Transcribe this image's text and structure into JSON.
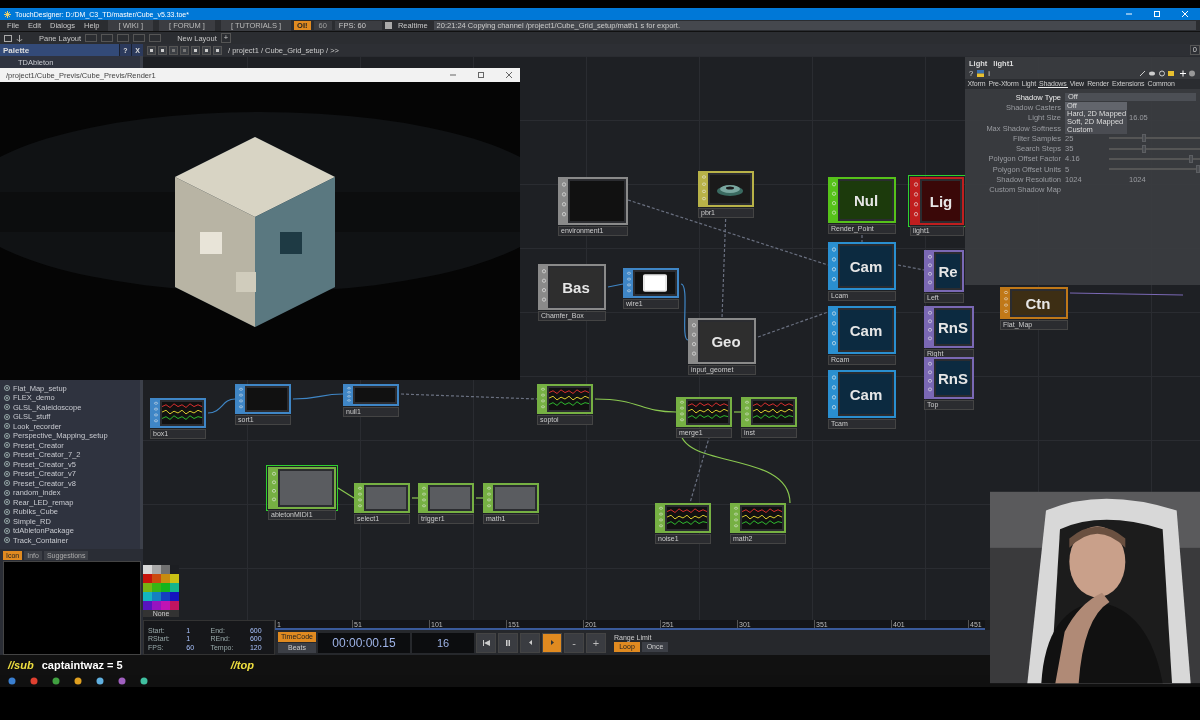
{
  "window": {
    "title": "TouchDesigner: D:/DM_C3_TD/master/Cube_v5.33.toe*"
  },
  "menu": [
    "File",
    "Edit",
    "Dialogs",
    "Help"
  ],
  "toolbar_links": [
    "[ WIKI ]",
    "[ FORUM ]",
    "[ TUTORIALS ]"
  ],
  "status": {
    "alert": "OI!",
    "fps_field": "60",
    "fps": "FPS: 60",
    "realtime": {
      "label": "Realtime",
      "checked": true
    },
    "message": "20:21:24 Copying channel /project1/Cube_Grid_setup/math1 s for export."
  },
  "pane_bar": {
    "pane_layout": "Pane Layout",
    "new_layout": "New Layout",
    "add": "+",
    "counter": "0"
  },
  "palette": {
    "title": "Palette",
    "help": "?",
    "close": "X",
    "first_item": "TDAbleton",
    "items": [
      "Flat_Map_setup",
      "FLEX_demo",
      "GLSL_Kaleidoscope",
      "GLSL_stuff",
      "Look_recorder",
      "Perspective_Mapping_setup",
      "Preset_Creator",
      "Preset_Creator_7_2",
      "Preset_Creator_v5",
      "Preset_Creator_v7",
      "Preset_Creator_v8",
      "random_index",
      "Rear_LED_remap",
      "Rubiks_Cube",
      "Simple_RD",
      "tdAbletonPackage",
      "Track_Container"
    ],
    "tabs": [
      {
        "label": "Icon",
        "selected": true
      },
      {
        "label": "Info",
        "selected": false
      },
      {
        "label": "Suggestions",
        "selected": false
      }
    ]
  },
  "path_bar": {
    "path": "/ project1 / Cube_Grid_setup / >>"
  },
  "render_window": {
    "title": "/project1/Cube_Previs/Cube_Previs/Render1",
    "kind": "picture"
  },
  "nodes": [
    {
      "label": "environment1",
      "kind": "texture",
      "selected": false
    },
    {
      "label": "pbr1",
      "kind": "material",
      "selected": false
    },
    {
      "label": "Render_Point",
      "title": "Nul",
      "kind": "null",
      "selected": false
    },
    {
      "label": "light1",
      "title": "Lig",
      "kind": "light",
      "selected": true
    },
    {
      "label": "Lcam",
      "title": "Cam",
      "kind": "camera",
      "selected": false
    },
    {
      "label": "Rcam",
      "title": "Cam",
      "kind": "camera",
      "selected": false
    },
    {
      "label": "Tcam",
      "title": "Cam",
      "kind": "camera",
      "selected": false
    },
    {
      "label": "Left",
      "title": "Re",
      "kind": "render",
      "selected": false
    },
    {
      "label": "Right",
      "title": "RnS",
      "kind": "render",
      "selected": false
    },
    {
      "label": "Top",
      "title": "RnS",
      "kind": "render",
      "selected": false
    },
    {
      "label": "Flat_Map",
      "title": "Ctn",
      "kind": "container",
      "selected": false
    },
    {
      "label": "Chamfer_Box",
      "title": "Bas",
      "kind": "geometry",
      "selected": false
    },
    {
      "label": "wire1",
      "kind": "wire",
      "selected": false
    },
    {
      "label": "input_geomet",
      "title": "Geo",
      "kind": "geometry",
      "selected": false
    },
    {
      "label": "soptoi",
      "kind": "chop",
      "selected": false
    },
    {
      "label": "merge1",
      "kind": "chop",
      "selected": false
    },
    {
      "label": "inst",
      "kind": "chop",
      "selected": false
    },
    {
      "label": "noise1",
      "kind": "chop",
      "selected": false
    },
    {
      "label": "math2",
      "kind": "chop",
      "selected": false
    },
    {
      "label": "box1",
      "kind": "data",
      "selected": false
    },
    {
      "label": "sort1",
      "kind": "sop",
      "selected": false
    },
    {
      "label": "null1",
      "kind": "sop",
      "selected": false
    },
    {
      "label": "abletonMIDI1",
      "kind": "value",
      "selected": true
    },
    {
      "label": "select1",
      "kind": "value",
      "selected": false
    },
    {
      "label": "trigger1",
      "kind": "value",
      "selected": false
    },
    {
      "label": "math1",
      "kind": "value",
      "selected": false
    }
  ],
  "parameters": {
    "op_type": "Light",
    "op_name": "light1",
    "help": "?",
    "info": "i",
    "tabs": [
      {
        "label": "Xform",
        "selected": false
      },
      {
        "label": "Pre-Xform",
        "selected": false
      },
      {
        "label": "Light",
        "selected": false
      },
      {
        "label": "Shadows",
        "selected": true
      },
      {
        "label": "View",
        "selected": false
      },
      {
        "label": "Render",
        "selected": false
      },
      {
        "label": "Extensions",
        "selected": false
      },
      {
        "label": "Common",
        "selected": false
      }
    ],
    "params": [
      {
        "name": "Shadow Type",
        "kind": "menu",
        "value": "Off",
        "disabled": false
      },
      {
        "name": "Shadow Casters",
        "kind": "field",
        "disabled": true
      },
      {
        "name": "Light Size",
        "kind": "field",
        "value": "16.05",
        "disabled": true
      },
      {
        "name": "Max Shadow Softness",
        "kind": "field",
        "disabled": true
      },
      {
        "name": "Filter Samples",
        "kind": "slider",
        "value": "25",
        "level": 0.39,
        "disabled": true
      },
      {
        "name": "Search Steps",
        "kind": "slider",
        "value": "35",
        "level": 0.39,
        "disabled": true
      },
      {
        "name": "Polygon Offset Factor",
        "kind": "slider",
        "value": "4.16",
        "level": 0.9,
        "disabled": true
      },
      {
        "name": "Polygon Offset Units",
        "kind": "slider",
        "value": "5",
        "level": 0.98,
        "disabled": true
      },
      {
        "name": "Shadow Resolution",
        "kind": "pair",
        "value": "1024",
        "value2": "1024",
        "disabled": true
      },
      {
        "name": "Custom Shadow Map",
        "kind": "field",
        "disabled": true
      }
    ],
    "dropdown": [
      {
        "label": "Off",
        "selected": true
      },
      {
        "label": "Hard, 2D Mapped",
        "selected": false
      },
      {
        "label": "Soft, 2D Mapped",
        "selected": false
      },
      {
        "label": "Custom",
        "selected": false
      }
    ]
  },
  "swatches": {
    "colors": [
      {
        "color": "#d8d8d8"
      },
      {
        "color": "#a8a8a8"
      },
      {
        "color": "#707070"
      },
      {
        "color": "#1c1e22"
      },
      {
        "color": "#c8140c"
      },
      {
        "color": "#cc4a10"
      },
      {
        "color": "#c88c10"
      },
      {
        "color": "#c8c014"
      },
      {
        "color": "#78b414"
      },
      {
        "color": "#38b414"
      },
      {
        "color": "#14b41c"
      },
      {
        "color": "#14b48c"
      },
      {
        "color": "#14b4c0"
      },
      {
        "color": "#1480c0"
      },
      {
        "color": "#1440c0"
      },
      {
        "color": "#1414c0"
      },
      {
        "color": "#5814c0"
      },
      {
        "color": "#9614c0"
      },
      {
        "color": "#c014b4"
      },
      {
        "color": "#c01460"
      }
    ],
    "none": "None"
  },
  "timeline": {
    "info": [
      {
        "label": "Start:",
        "value": "1"
      },
      {
        "label": "End:",
        "value": "600"
      },
      {
        "label": "RStart:",
        "value": "1"
      },
      {
        "label": "REnd:",
        "value": "600"
      },
      {
        "label": "FPS:",
        "value": "60"
      },
      {
        "label": "Tempo:",
        "value": "120"
      }
    ],
    "ruler": [
      "1",
      "51",
      "101",
      "151",
      "201",
      "251",
      "301",
      "351",
      "401",
      "451"
    ],
    "modes": [
      {
        "label": "TimeCode",
        "selected": true
      },
      {
        "label": "Beats",
        "selected": false
      }
    ],
    "timecode": "00:00:00.15",
    "frame": "16",
    "transport": [
      {
        "kind": "rewind",
        "selected": false
      },
      {
        "kind": "pause",
        "selected": false
      },
      {
        "kind": "back",
        "selected": false
      },
      {
        "kind": "play",
        "selected": true
      },
      {
        "kind": "minus",
        "label": "-",
        "selected": false
      },
      {
        "kind": "plus",
        "label": "+",
        "selected": false
      }
    ],
    "range_limit": {
      "label": "Range Limit",
      "options": [
        {
          "label": "Loop",
          "selected": true
        },
        {
          "label": "Once",
          "selected": false
        }
      ]
    }
  },
  "stream_overlay": {
    "left_tag": "//sub",
    "command": "captaintwaz = 5",
    "right_tag": "//top"
  },
  "webcam": {
    "kind": "picture"
  }
}
